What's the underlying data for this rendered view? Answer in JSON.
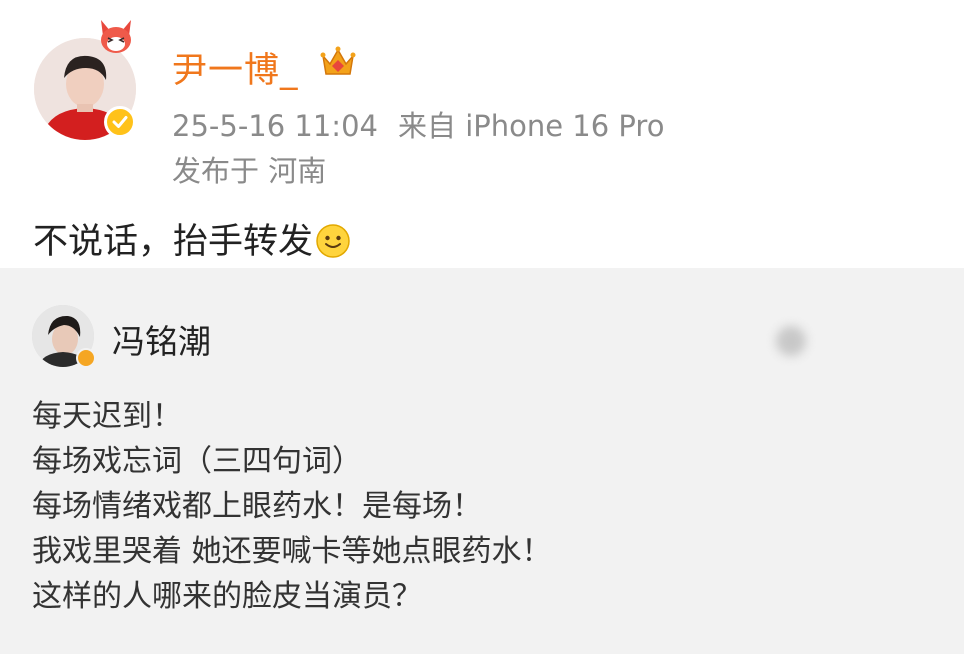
{
  "post": {
    "username": "尹一博_",
    "time": "25-5-16 11:04",
    "source": "来自 iPhone 16 Pro",
    "location": "发布于 河南",
    "text": "不说话，抬手转发"
  },
  "repost": {
    "author": "冯铭潮",
    "lines": [
      "每天迟到！",
      "每场戏忘词（三四句词）",
      "每场情绪戏都上眼药水！是每场！",
      "我戏里哭着 她还要喊卡等她点眼药水！",
      "这样的人哪来的脸皮当演员？"
    ]
  },
  "colors": {
    "username": "#f0771c",
    "meta": "#8a8a8a",
    "repost_bg": "#f2f2f2",
    "verified": "#ffc21a"
  },
  "icons": [
    "fox-sticker-icon",
    "crown-vip-icon",
    "verified-badge-icon",
    "smile-emoji-icon"
  ]
}
